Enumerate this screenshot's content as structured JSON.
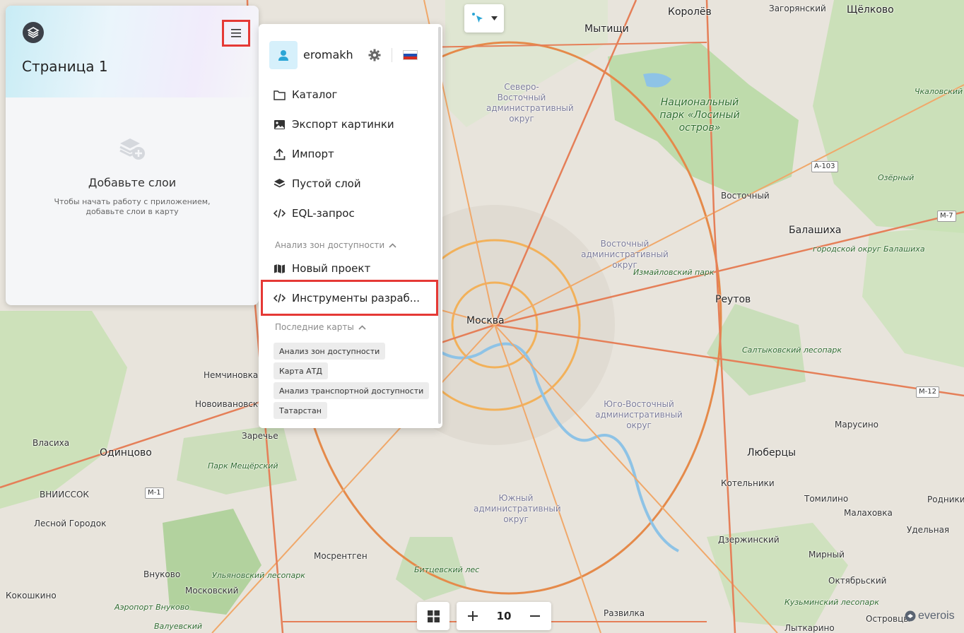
{
  "left_panel": {
    "page_title": "Страница 1",
    "empty_state": {
      "title": "Добавьте слои",
      "description": "Чтобы начать работу с приложением, добавьте слои в карту"
    }
  },
  "menu": {
    "user": {
      "name": "eromakh"
    },
    "items": [
      {
        "label": "Каталог",
        "icon": "folder-icon"
      },
      {
        "label": "Экспорт картинки",
        "icon": "image-icon"
      },
      {
        "label": "Импорт",
        "icon": "upload-icon"
      },
      {
        "label": "Пустой слой",
        "icon": "layers-icon"
      },
      {
        "label": "EQL-запрос",
        "icon": "code-icon"
      }
    ],
    "section_access": {
      "title": "Анализ зон доступности",
      "items": [
        {
          "label": "Новый проект",
          "icon": "map-icon"
        },
        {
          "label": "Инструменты разраб...",
          "icon": "code-icon"
        }
      ]
    },
    "section_recent": {
      "title": "Последние карты",
      "chips": [
        "Анализ зон доступности",
        "Карта АТД",
        "Анализ транспортной доступности",
        "Татарстан"
      ]
    }
  },
  "controls": {
    "zoom_level": "10",
    "brand": "everois"
  },
  "map": {
    "cities_big": [
      "Москва",
      "Балашиха",
      "Реутов",
      "Люберцы",
      "Одинцово",
      "Мытищи",
      "Королёв",
      "Щёлково"
    ],
    "labels": [
      "Загорянский",
      "Восточный",
      "Немчиновка",
      "Новоивановское",
      "Заречье",
      "Власиха",
      "ВНИИССОК",
      "Лесной Городок",
      "Внуково",
      "Московский",
      "Кокошкино",
      "Мосрентген",
      "Развилка",
      "Котельники",
      "Дзержинский",
      "Томилино",
      "Малаховка",
      "Удельная",
      "Мирный",
      "Октябрьский",
      "Марусино",
      "Родники",
      "Островцы",
      "Лыткарино",
      "Чкаловский"
    ],
    "districts": [
      "Северо-Восточный административный округ",
      "Восточный административный округ",
      "Юго-Восточный административный округ",
      "Южный административный округ"
    ],
    "parks": [
      "Национальный парк «Лосиный остров»"
    ],
    "green_labels": [
      "Измайловский парк",
      "Парк Мещёрский",
      "Салтыковский лесопарк",
      "городской округ Балашиха",
      "Озёрный",
      "Битцевский лес",
      "Ульяновский лесопарк",
      "Аэропорт Внуково",
      "Валуевский",
      "Кузьминский лесопарк"
    ],
    "road_badges": [
      "А-103",
      "М-7",
      "М-12",
      "М-1"
    ]
  }
}
